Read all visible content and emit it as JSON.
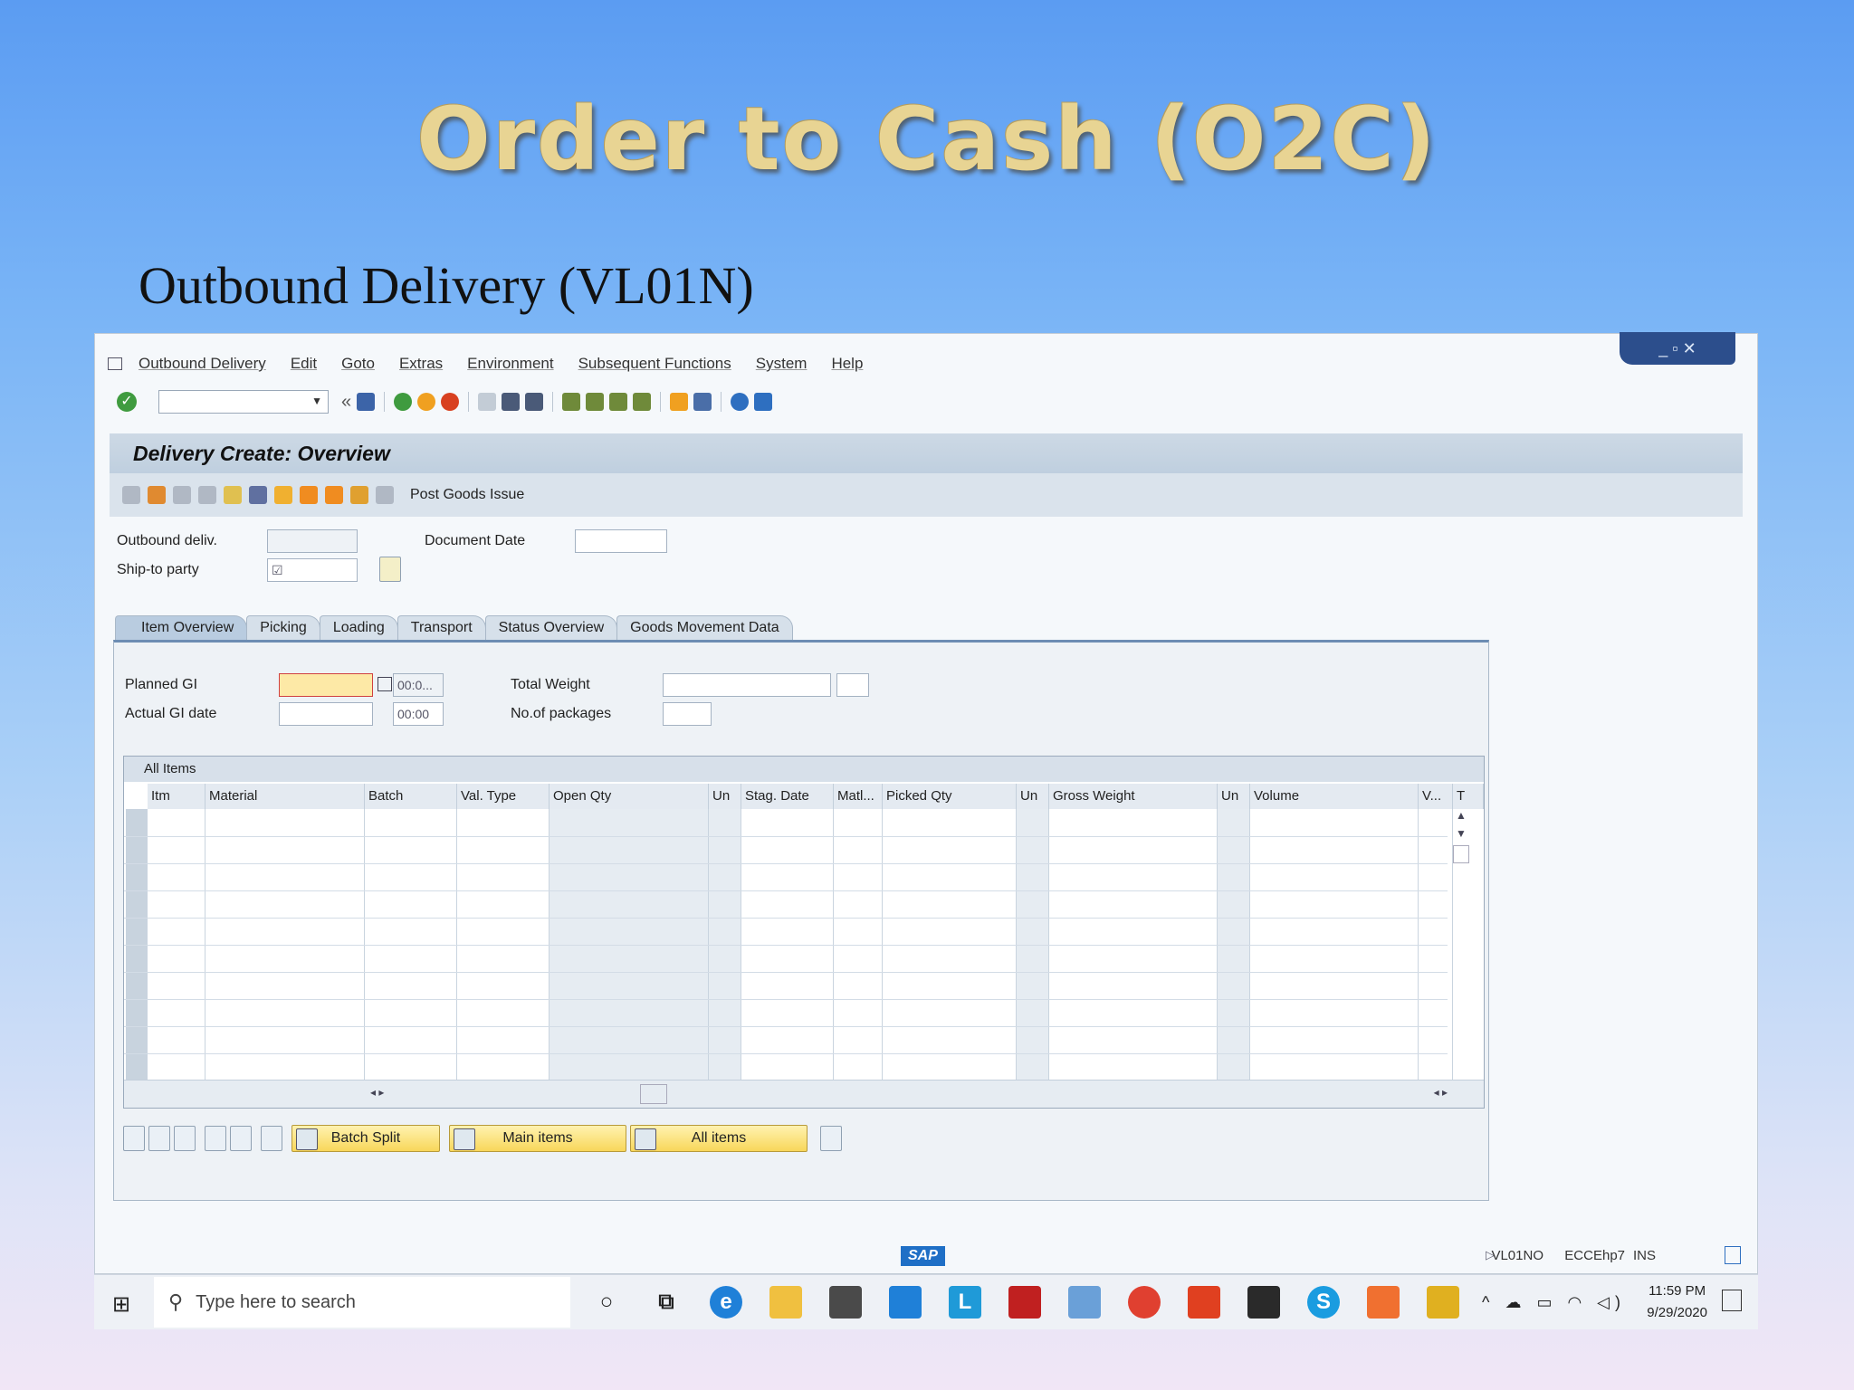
{
  "slide": {
    "title": "Order to Cash (O2C)",
    "subtitle": "Outbound Delivery (VL01N)"
  },
  "sap": {
    "menu": [
      "Outbound Delivery",
      "Edit",
      "Goto",
      "Extras",
      "Environment",
      "Subsequent Functions",
      "System",
      "Help"
    ],
    "window_controls": "_ ▫ ✕",
    "screen_title": "Delivery  Create: Overview",
    "app_toolbar": {
      "post_goods_issue": "Post Goods Issue"
    },
    "header_fields": {
      "outbound_delivery_label": "Outbound deliv.",
      "document_date_label": "Document Date",
      "ship_to_party_label": "Ship-to party",
      "ship_to_party_value": "☑"
    },
    "tabs": [
      "Item Overview",
      "Picking",
      "Loading",
      "Transport",
      "Status Overview",
      "Goods Movement Data"
    ],
    "item_overview": {
      "planned_gi_label": "Planned GI",
      "planned_gi_time": "00:0...",
      "actual_gi_label": "Actual GI date",
      "actual_gi_time": "00:00",
      "total_weight_label": "Total Weight",
      "packages_label": "No.of packages"
    },
    "table": {
      "title": "All Items",
      "columns": [
        "Itm",
        "Material",
        "Batch",
        "Val. Type",
        "Open Qty",
        "Un",
        "Stag. Date",
        "Matl...",
        "Picked Qty",
        "Un",
        "Gross Weight",
        "Un",
        "Volume",
        "V...",
        "T"
      ],
      "rows": []
    },
    "buttons": {
      "batch_split": "Batch Split",
      "main_items": "Main items",
      "all_items": "All items"
    },
    "status": {
      "logo": "SAP",
      "transaction": "VL01NO",
      "system": "ECCEhp7",
      "mode": "INS"
    }
  },
  "taskbar": {
    "search_placeholder": "Type here to search",
    "time": "11:59 PM",
    "date": "9/29/2020"
  },
  "colors": {
    "accent": "#f8d75a",
    "sap_header": "#cdd9e5",
    "slide_title": "#e8d493"
  }
}
